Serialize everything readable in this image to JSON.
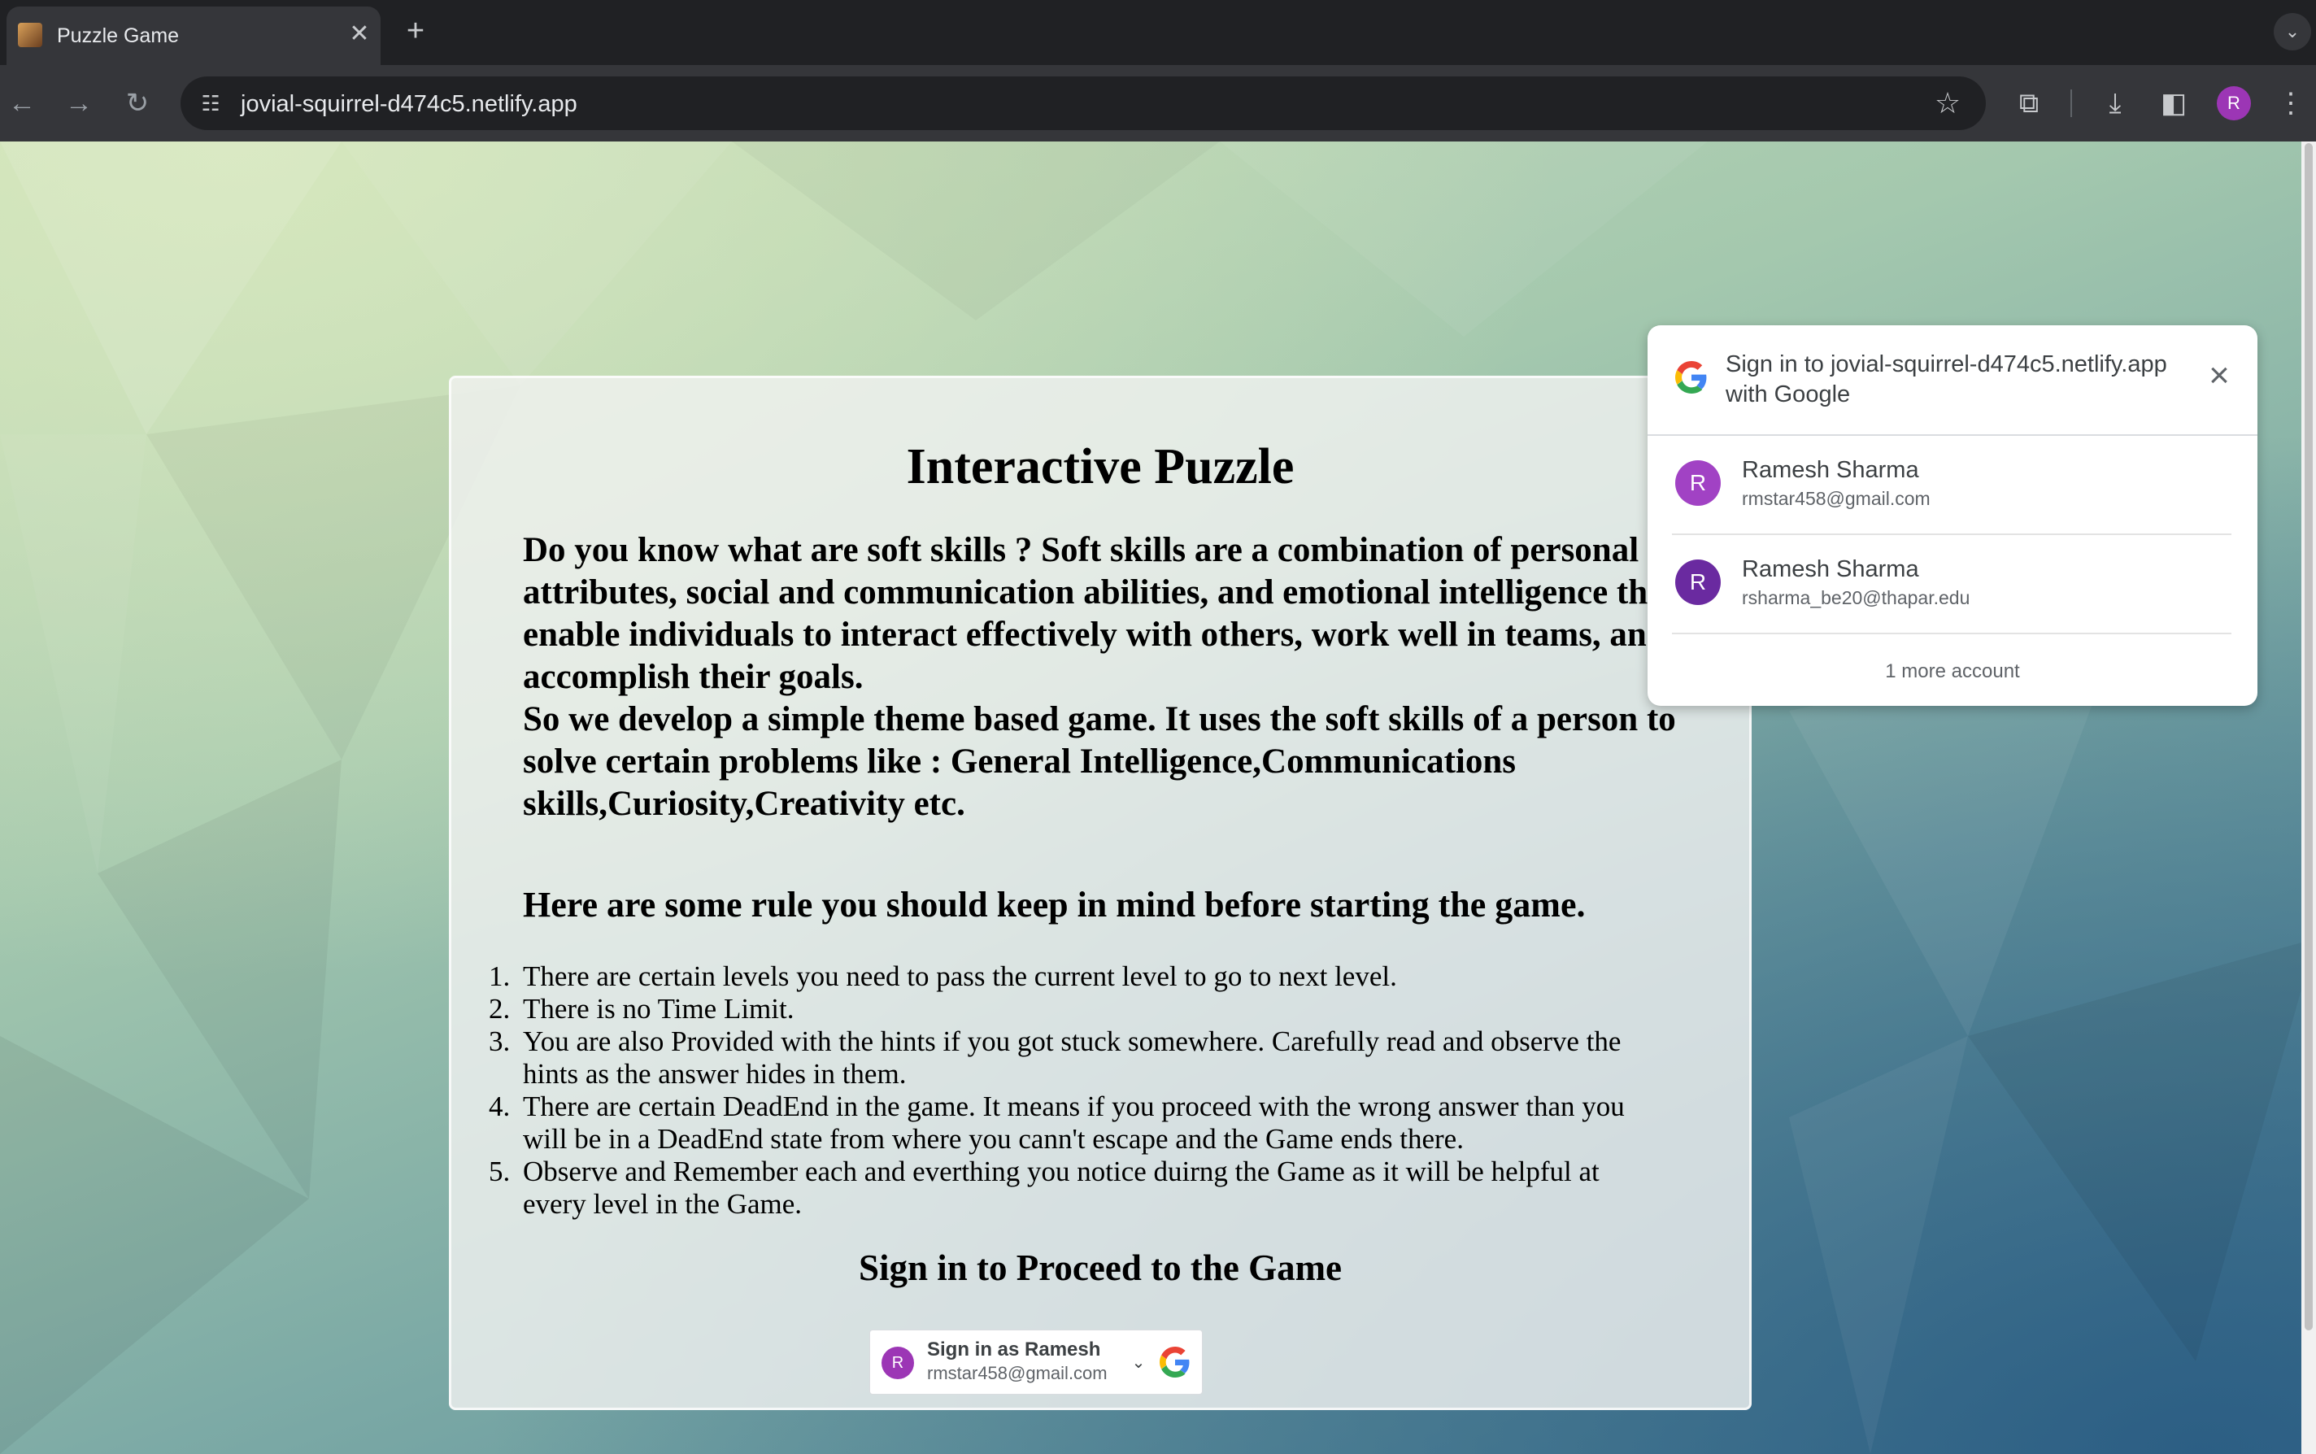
{
  "browser": {
    "tab_title": "Puzzle Game",
    "tab_close_glyph": "✕",
    "new_tab_glyph": "+",
    "url": "jovial-squirrel-d474c5.netlify.app",
    "profile_initial": "R",
    "icons": [
      "back-icon",
      "forward-icon",
      "reload-icon",
      "site-info-icon",
      "star-icon",
      "extensions-icon",
      "download-icon",
      "side-panel-icon",
      "menu-icon",
      "tab-search-icon"
    ]
  },
  "page": {
    "title": "Interactive Puzzle",
    "intro_p1": "Do you know what are soft skills ? Soft skills are a combination of personal attributes, social and communication abilities, and emotional intelligence that enable individuals to interact effectively with others, work well in teams, and accomplish their goals.",
    "intro_p2": "So we develop a simple theme based game. It uses the soft skills of a person to solve certain problems like : General Intelligence,Communications skills,Curiosity,Creativity etc.",
    "rules_heading": "Here are some rule you should keep in mind before starting the game.",
    "rules": [
      {
        "num": "1.",
        "text": "There are certain levels you need to pass the current level to go to next level."
      },
      {
        "num": "2.",
        "text": "There is no Time Limit."
      },
      {
        "num": "3.",
        "text": "You are also Provided with the hints if you got stuck somewhere. Carefully read and observe the hints as the answer hides in them."
      },
      {
        "num": "4.",
        "text": "There are certain DeadEnd in the game. It means if you proceed with the wrong answer than you will be in a DeadEnd state from where you cann't escape and the Game ends there."
      },
      {
        "num": "5.",
        "text": "Observe and Remember each and everthing you notice duirng the Game as it will be helpful at every level in the Game."
      }
    ],
    "signin_heading": "Sign in to Proceed to the Game",
    "signin_button": {
      "initial": "R",
      "label": "Sign in as Ramesh",
      "email": "rmstar458@gmail.com"
    }
  },
  "onetap": {
    "title": "Sign in to jovial-squirrel-d474c5.netlify.app with Google",
    "accounts": [
      {
        "initial": "R",
        "name": "Ramesh Sharma",
        "email": "rmstar458@gmail.com",
        "color": "#a142c4"
      },
      {
        "initial": "R",
        "name": "Ramesh Sharma",
        "email": "rsharma_be20@thapar.edu",
        "color": "#6a2aa0"
      }
    ],
    "more_accounts": "1 more account"
  },
  "colors": {
    "chrome_dark": "#202124",
    "toolbar": "#35363a",
    "avatar_purple": "#9c36b5",
    "google_blue": "#4285F4",
    "google_red": "#EA4335",
    "google_yellow": "#FBBC05",
    "google_green": "#34A853"
  }
}
